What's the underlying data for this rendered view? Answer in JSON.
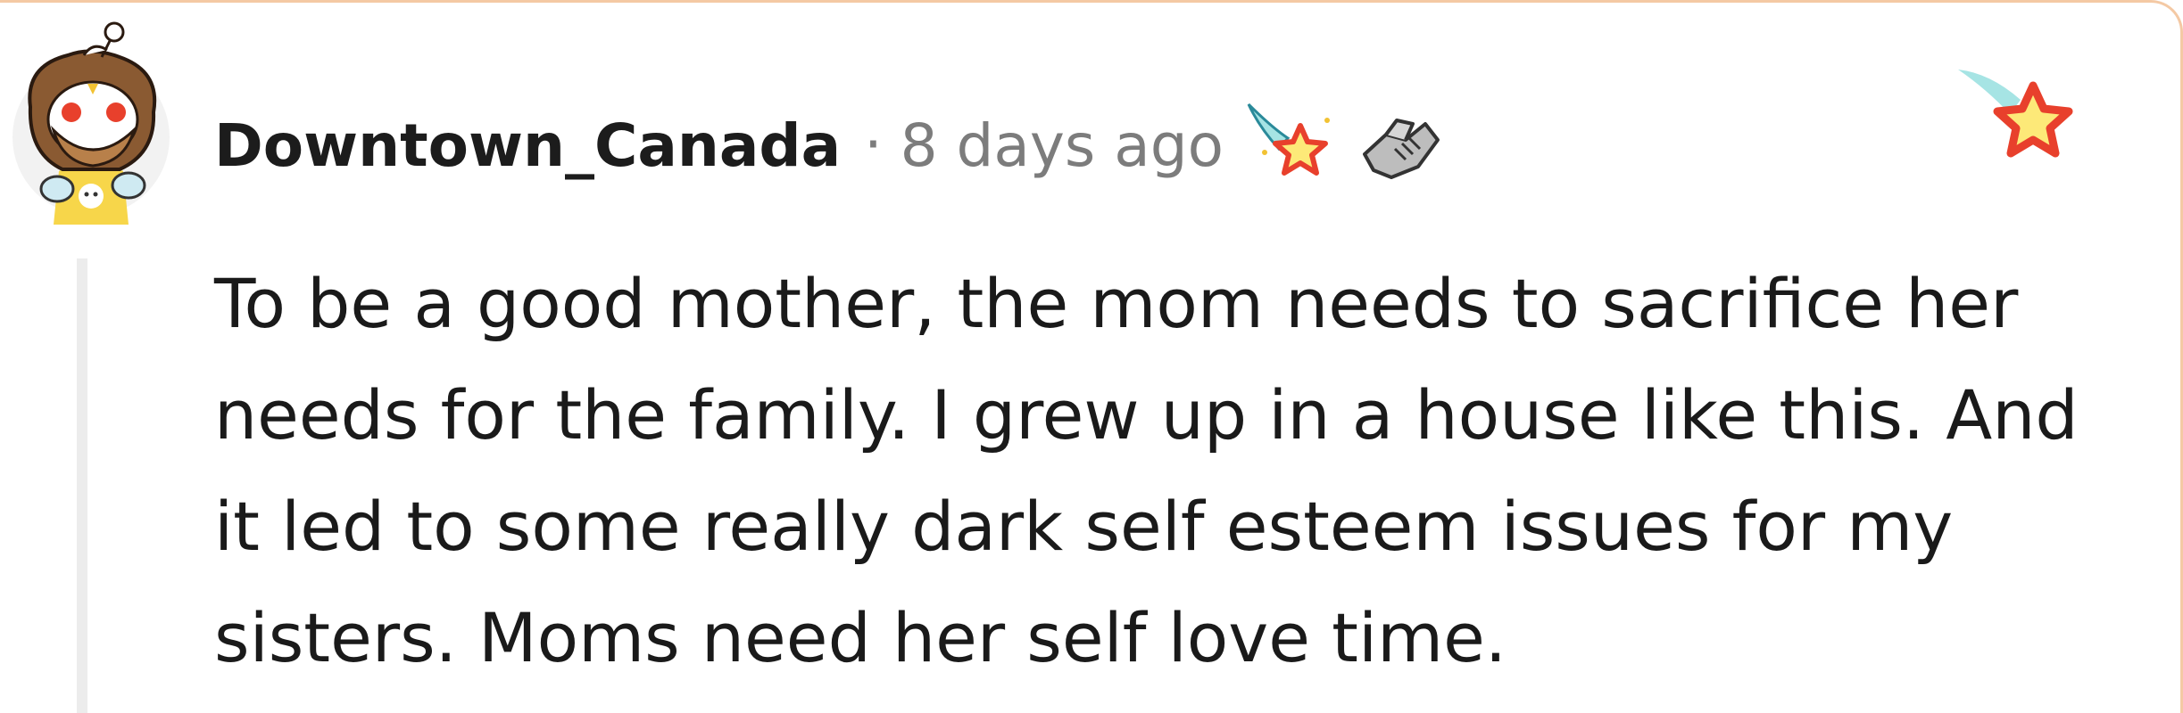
{
  "comment": {
    "username": "Downtown_Canada",
    "separator": "·",
    "timestamp": "8 days ago",
    "body": "To be a good mother, the mom needs to sacrifice her needs for the family. I grew up in a house like this. And it led to some really dark self esteem issues for my sisters. Moms need her self love time.",
    "awards": [
      {
        "icon": "shooting-star-award-icon"
      },
      {
        "icon": "handshake-award-icon"
      }
    ],
    "corner_icon": "shooting-star-icon"
  },
  "colors": {
    "username": "#1c1c1c",
    "timestamp": "#7c7c7c",
    "body": "#1a1a1a",
    "thread_line": "#ececec",
    "star_fill": "#fde978",
    "star_outline": "#e8402c",
    "star_trail": "#a6e4e4",
    "frame_border": "#f4c9a4"
  }
}
